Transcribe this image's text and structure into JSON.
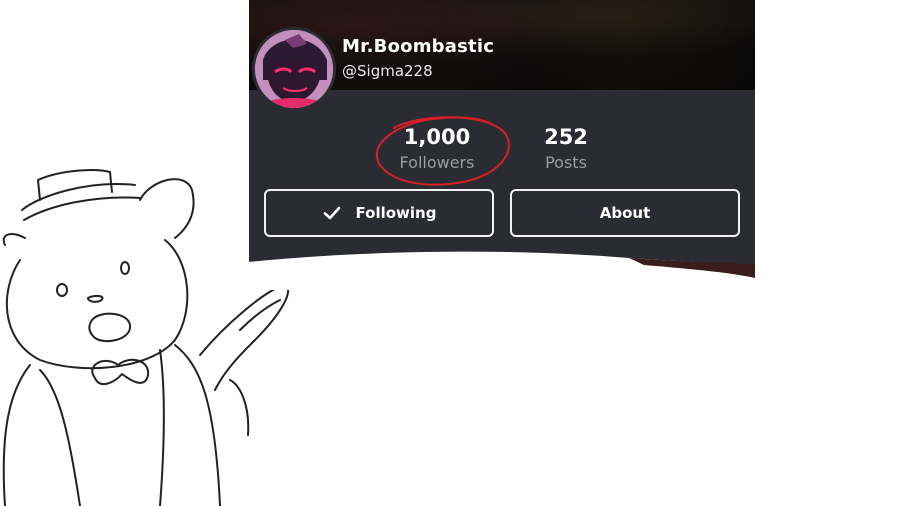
{
  "profile": {
    "display_name": "Mr.Boombastic",
    "handle": "@Sigma228"
  },
  "stats": [
    {
      "value": "1,000",
      "label": "Followers"
    },
    {
      "value": "252",
      "label": "Posts"
    }
  ],
  "actions": {
    "following_label": "Following",
    "about_label": "About"
  },
  "icons": {
    "following": "checkmark-icon",
    "avatar": "avatar-image"
  },
  "colors": {
    "card_background": "#2b2c33",
    "annotation": "#d81f26",
    "label_gray": "#9a9ba3"
  }
}
